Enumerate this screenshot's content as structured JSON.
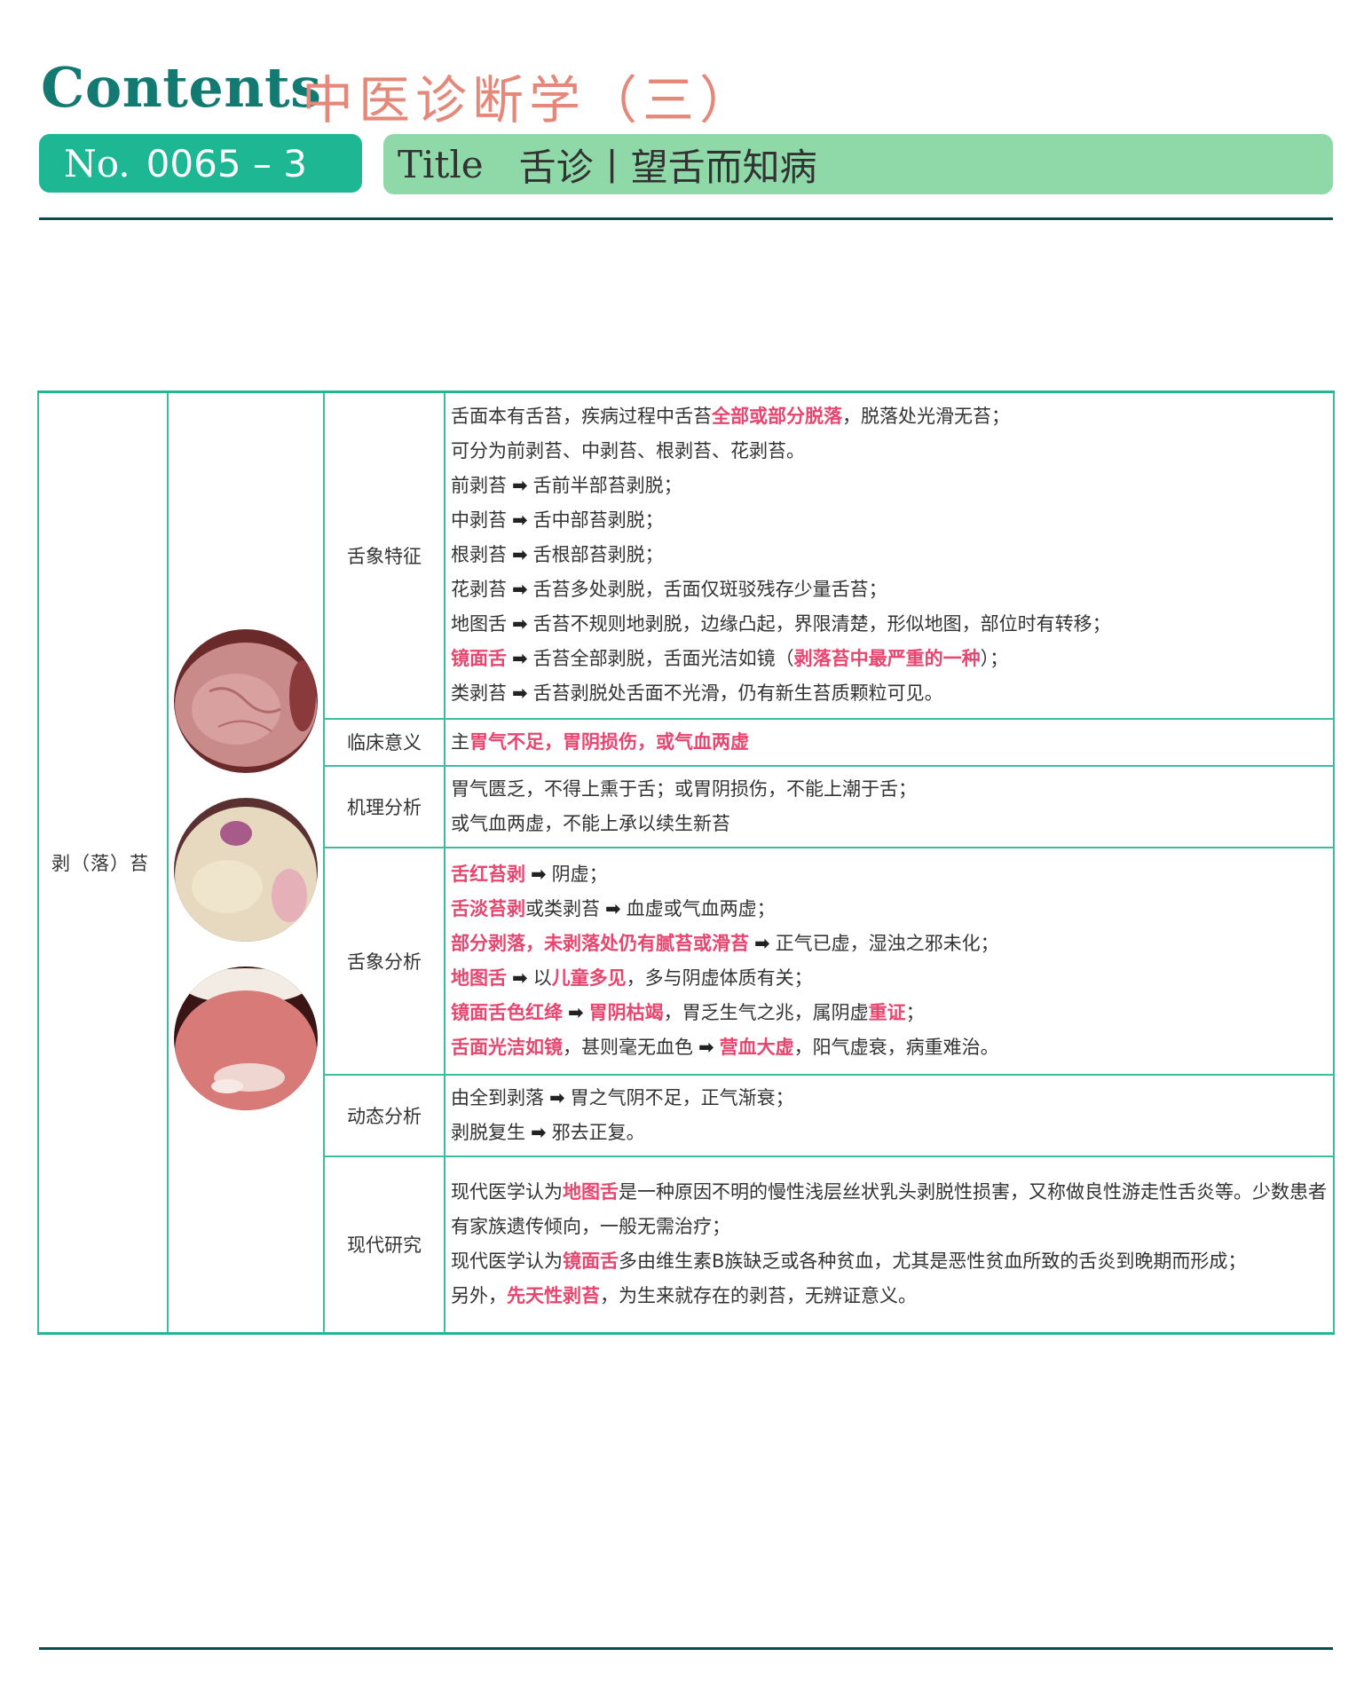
{
  "header": {
    "contents_label": "Contents",
    "subject": "中医诊断学（三）",
    "no_label": "No.",
    "no_value": "0065 – 3",
    "title_label": "Title",
    "title_value": "舌诊丨望舌而知病"
  },
  "colors": {
    "teal": "#137a72",
    "salmon": "#e5887a",
    "green_pill": "#1db794",
    "light_pill": "#8fd9a9",
    "highlight": "#e8456f",
    "border": "#3cbca0"
  },
  "table": {
    "name": "剥（落）苔",
    "images": [
      "tongue-photo-1",
      "tongue-photo-2",
      "tongue-photo-3"
    ],
    "rows": [
      {
        "category": "舌象特征",
        "lines": [
          [
            {
              "t": "舌面本有舌苔，疾病过程中舌苔"
            },
            {
              "t": "全部或部分脱落",
              "h": true
            },
            {
              "t": "，脱落处光滑无苔；"
            }
          ],
          [
            {
              "t": "可分为前剥苔、中剥苔、根剥苔、花剥苔。"
            }
          ],
          [
            {
              "t": "前剥苔"
            },
            {
              "t": "➡",
              "a": true
            },
            {
              "t": "舌前半部苔剥脱；"
            }
          ],
          [
            {
              "t": "中剥苔"
            },
            {
              "t": "➡",
              "a": true
            },
            {
              "t": "舌中部苔剥脱；"
            }
          ],
          [
            {
              "t": "根剥苔"
            },
            {
              "t": "➡",
              "a": true
            },
            {
              "t": "舌根部苔剥脱；"
            }
          ],
          [
            {
              "t": "花剥苔"
            },
            {
              "t": "➡",
              "a": true
            },
            {
              "t": "舌苔多处剥脱，舌面仅斑驳残存少量舌苔；"
            }
          ],
          [
            {
              "t": "地图舌"
            },
            {
              "t": "➡",
              "a": true
            },
            {
              "t": "舌苔不规则地剥脱，边缘凸起，界限清楚，形似地图，部位时有转移；"
            }
          ],
          [
            {
              "t": "镜面舌",
              "h": true
            },
            {
              "t": "➡",
              "a": true
            },
            {
              "t": "舌苔全部剥脱，舌面光洁如镜（"
            },
            {
              "t": "剥落苔中最严重的一种",
              "h": true
            },
            {
              "t": "）；"
            }
          ],
          [
            {
              "t": "类剥苔"
            },
            {
              "t": "➡",
              "a": true
            },
            {
              "t": "舌苔剥脱处舌面不光滑，仍有新生苔质颗粒可见。"
            }
          ]
        ]
      },
      {
        "category": "临床意义",
        "lines": [
          [
            {
              "t": "主"
            },
            {
              "t": "胃气不足，胃阴损伤，或气血两虚",
              "h": true
            }
          ]
        ]
      },
      {
        "category": "机理分析",
        "lines": [
          [
            {
              "t": "胃气匮乏，不得上熏于舌；或胃阴损伤，不能上潮于舌；"
            }
          ],
          [
            {
              "t": "或气血两虚，不能上承以续生新苔"
            }
          ]
        ]
      },
      {
        "category": "舌象分析",
        "lines": [
          [
            {
              "t": "舌红苔剥",
              "h": true
            },
            {
              "t": "➡",
              "a": true
            },
            {
              "t": "阴虚；"
            }
          ],
          [
            {
              "t": "舌淡苔剥",
              "h": true
            },
            {
              "t": "或类剥苔"
            },
            {
              "t": "➡",
              "a": true
            },
            {
              "t": "血虚或气血两虚；"
            }
          ],
          [
            {
              "t": "部分剥落，未剥落处仍有腻苔或滑苔",
              "h": true
            },
            {
              "t": "➡",
              "a": true
            },
            {
              "t": "正气已虚，湿浊之邪未化；"
            }
          ],
          [
            {
              "t": "地图舌",
              "h": true
            },
            {
              "t": "➡",
              "a": true
            },
            {
              "t": "以"
            },
            {
              "t": "儿童多见",
              "h": true
            },
            {
              "t": "，多与阴虚体质有关；"
            }
          ],
          [
            {
              "t": "镜面舌色红绛",
              "h": true
            },
            {
              "t": "➡",
              "a": true
            },
            {
              "t": "胃阴枯竭",
              "h": true
            },
            {
              "t": "，胃乏生气之兆，属阴虚"
            },
            {
              "t": "重证",
              "h": true
            },
            {
              "t": "；"
            }
          ],
          [
            {
              "t": "舌面光洁如镜",
              "h": true
            },
            {
              "t": "，甚则毫无血色"
            },
            {
              "t": "➡",
              "a": true
            },
            {
              "t": "营血大虚",
              "h": true
            },
            {
              "t": "，阳气虚衰，病重难治。"
            }
          ]
        ]
      },
      {
        "category": "动态分析",
        "lines": [
          [
            {
              "t": "由全到剥落"
            },
            {
              "t": "➡",
              "a": true
            },
            {
              "t": "胃之气阴不足，正气渐衰；"
            }
          ],
          [
            {
              "t": "剥脱复生"
            },
            {
              "t": "➡",
              "a": true
            },
            {
              "t": "邪去正复。"
            }
          ]
        ]
      },
      {
        "category": "现代研究",
        "lines": [
          [
            {
              "t": "现代医学认为"
            },
            {
              "t": "地图舌",
              "h": true
            },
            {
              "t": "是一种原因不明的慢性浅层丝状乳头剥脱性损害，又称做良性游走性舌炎等。少数患者有家族遗传倾向，一般无需治疗；"
            }
          ],
          [
            {
              "t": "现代医学认为"
            },
            {
              "t": "镜面舌",
              "h": true
            },
            {
              "t": "多由维生素B族缺乏或各种贫血，尤其是恶性贫血所致的舌炎到晚期而形成；"
            }
          ],
          [
            {
              "t": "另外，"
            },
            {
              "t": "先天性剥苔",
              "h": true
            },
            {
              "t": "，为生来就存在的剥苔，无辨证意义。"
            }
          ]
        ]
      }
    ]
  }
}
